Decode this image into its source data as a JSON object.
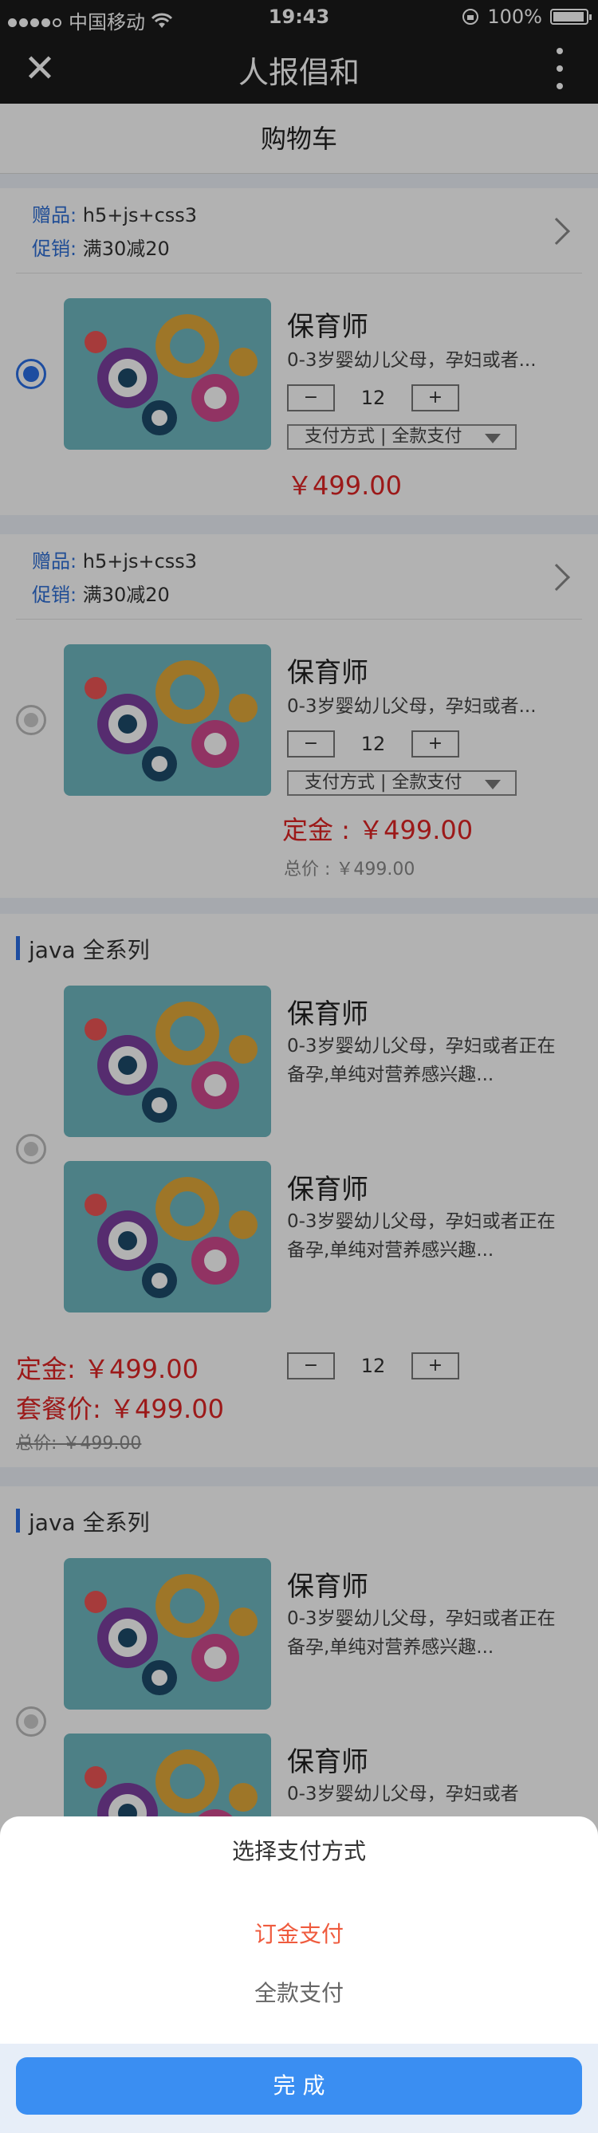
{
  "status": {
    "carrier": "中国移动",
    "time": "19:43",
    "battery": "100%"
  },
  "nav": {
    "title": "人报倡和"
  },
  "page": {
    "title": "购物车"
  },
  "colors": {
    "accent": "#2a6fe6",
    "price": "#e02424",
    "button": "#3a8ef2"
  },
  "cards": [
    {
      "gift_label": "赠品:",
      "gift_value": "h5+js+css3",
      "promo_label": "促销:",
      "promo_value": "满30减20",
      "product": {
        "name": "保育师",
        "desc": "0-3岁婴幼儿父母，孕妇或者...",
        "qty": "12",
        "pay": "支付方式 | 全款支付",
        "price": "￥499.00"
      }
    },
    {
      "gift_label": "赠品:",
      "gift_value": "h5+js+css3",
      "promo_label": "促销:",
      "promo_value": "满30减20",
      "product": {
        "name": "保育师",
        "desc": "0-3岁婴幼儿父母，孕妇或者...",
        "qty": "12",
        "pay": "支付方式 | 全款支付",
        "price": "定金 : ￥499.00",
        "total": "总价 : ￥499.00"
      }
    }
  ],
  "packages": [
    {
      "title": "java 全系列",
      "items": [
        {
          "name": "保育师",
          "desc": "0-3岁婴幼儿父母，孕妇或者正在备孕,单纯对营养感兴趣..."
        },
        {
          "name": "保育师",
          "desc": "0-3岁婴幼儿父母，孕妇或者正在备孕,单纯对营养感兴趣..."
        }
      ],
      "deposit": "定金:  ￥499.00",
      "bundle_price": "套餐价:  ￥499.00",
      "total": "总价:  ￥499.00",
      "qty": "12"
    },
    {
      "title": "java 全系列",
      "items": [
        {
          "name": "保育师",
          "desc": "0-3岁婴幼儿父母，孕妇或者正在备孕,单纯对营养感兴趣..."
        },
        {
          "name": "保育师",
          "desc": "0-3岁婴幼儿父母，孕妇或者"
        }
      ]
    }
  ],
  "sheet": {
    "title": "选择支付方式",
    "option_deposit": "订金支付",
    "option_full": "全款支付",
    "done": "完 成"
  }
}
